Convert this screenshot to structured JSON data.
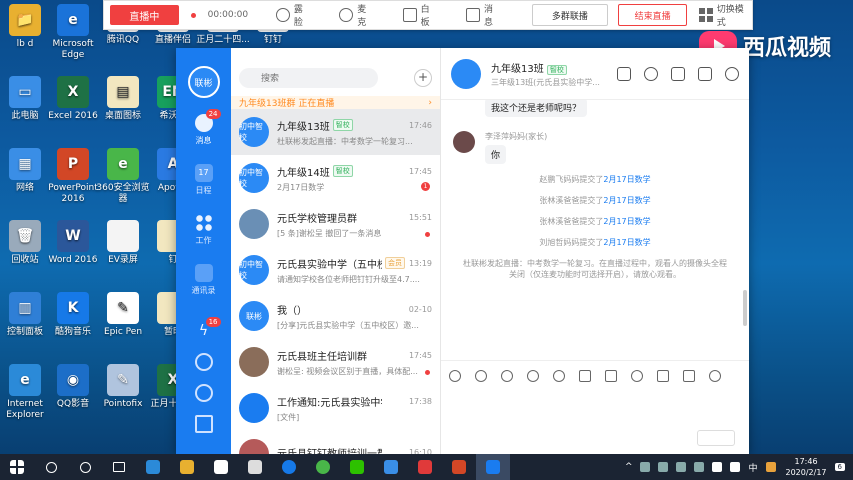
{
  "desktop": {
    "icons": [
      {
        "label": "lb d",
        "color": "#e8b030",
        "glyph": "📁"
      },
      {
        "label": "Microsoft Edge",
        "color": "#1a73d9",
        "glyph": "e"
      },
      {
        "label": "腾讯QQ",
        "color": "#f5f5f5",
        "glyph": ""
      },
      {
        "label": "直播伴侣",
        "color": "#f5f5f5",
        "glyph": ""
      },
      {
        "label": "正月二十四...",
        "color": "#f5f5f5",
        "glyph": ""
      },
      {
        "label": "钉钉",
        "color": "#f5f5f5",
        "glyph": ""
      },
      {
        "label": "此电脑",
        "color": "#3a8ee6",
        "glyph": "▭"
      },
      {
        "label": "Excel 2016",
        "color": "#1e7145",
        "glyph": "X"
      },
      {
        "label": "桌面图标",
        "color": "#f2e7c0",
        "glyph": "▤"
      },
      {
        "label": "希沃白",
        "color": "#17a05d",
        "glyph": "EN"
      },
      {
        "label": "网络",
        "color": "#3a8ee6",
        "glyph": "▦"
      },
      {
        "label": "PowerPoint 2016",
        "color": "#d24726",
        "glyph": "P"
      },
      {
        "label": "360安全浏览器",
        "color": "#49b649",
        "glyph": "e"
      },
      {
        "label": "Apowe",
        "color": "#2a7ae2",
        "glyph": "A"
      },
      {
        "label": "回收站",
        "color": "#9ab",
        "glyph": "🗑"
      },
      {
        "label": "Word 2016",
        "color": "#2b579a",
        "glyph": "W"
      },
      {
        "label": "EV录屏",
        "color": "#f4f4f4",
        "glyph": ""
      },
      {
        "label": "钉",
        "color": "#f2e7c0",
        "glyph": ""
      },
      {
        "label": "控制面板",
        "color": "#2f7fd6",
        "glyph": "▥"
      },
      {
        "label": "酷狗音乐",
        "color": "#1679e8",
        "glyph": "K"
      },
      {
        "label": "Epic Pen",
        "color": "#fff",
        "glyph": "✎"
      },
      {
        "label": "暂时",
        "color": "#f2e7c0",
        "glyph": ""
      },
      {
        "label": "Internet Explorer",
        "color": "#2b8ad8",
        "glyph": "e"
      },
      {
        "label": "QQ影音",
        "color": "#1c6ec8",
        "glyph": "◉"
      },
      {
        "label": "Pointofix",
        "color": "#b0c4de",
        "glyph": "✎"
      },
      {
        "label": "正月十三直",
        "color": "#1e7145",
        "glyph": "X"
      }
    ]
  },
  "live_bar": {
    "live_label": "直播中",
    "timer": "00:00:00",
    "tools": [
      "露脸",
      "麦克",
      "白板",
      "消息"
    ],
    "multi_live": "多群联播",
    "end_live": "结束直播",
    "switch_mode": "切换模式"
  },
  "watermark": {
    "text": "西瓜视频"
  },
  "rail": {
    "avatar_text": "联彬",
    "nav": [
      {
        "label": "消息",
        "badge": "24"
      },
      {
        "label": "日程",
        "badge": ""
      },
      {
        "label": "工作",
        "badge": ""
      },
      {
        "label": "通讯录",
        "badge": ""
      }
    ],
    "bottom_badge": "16"
  },
  "list": {
    "search_placeholder": "搜索",
    "live_banner": "九年级13班群 正在直播",
    "conversations": [
      {
        "name": "九年级13班",
        "tag": "智校",
        "tag_type": "green",
        "time": "17:46",
        "preview": "杜联彬发起直播：中考数学一轮复习...",
        "avatar_color": "#2b8af5",
        "avatar_text": "初中智校",
        "unread": ""
      },
      {
        "name": "九年级14班",
        "tag": "智校",
        "tag_type": "green",
        "time": "17:45",
        "preview": "2月17日数学",
        "avatar_color": "#2b8af5",
        "avatar_text": "初中智校",
        "unread": "1"
      },
      {
        "name": "元氏学校管理员群",
        "tag": "",
        "tag_type": "",
        "time": "15:51",
        "preview": "[5 条]谢松呈 撤回了一条消息",
        "avatar_color": "#6a8fb5",
        "avatar_text": "",
        "unread": "•"
      },
      {
        "name": "元氏县实验中学（五中校...",
        "tag": "会员",
        "tag_type": "vip",
        "time": "13:19",
        "preview": "请通知学校各位老师把钉钉升级至4.7....",
        "avatar_color": "#2b8af5",
        "avatar_text": "初中智校",
        "unread": ""
      },
      {
        "name": "我（）",
        "tag": "",
        "tag_type": "",
        "time": "02-10",
        "preview": "[分享]元氏县实验中学（五中校区）邀...",
        "avatar_color": "#2b8af5",
        "avatar_text": "联彬",
        "unread": ""
      },
      {
        "name": "元氏县班主任培训群",
        "tag": "",
        "tag_type": "",
        "time": "17:45",
        "preview": "谢松呈: 视频会议区别于直播，具体配...",
        "avatar_color": "#8a6d5a",
        "avatar_text": "",
        "unread": "•"
      },
      {
        "name": "工作通知:元氏县实验中学（五...",
        "tag": "",
        "tag_type": "",
        "time": "17:38",
        "preview": "[文件]",
        "avatar_color": "#1a7cf0",
        "avatar_text": "",
        "unread": ""
      },
      {
        "name": "元氏县钉钉教师培训一群",
        "tag": "",
        "tag_type": "",
        "time": "16:10",
        "preview": "",
        "avatar_color": "#b55a5a",
        "avatar_text": "",
        "unread": ""
      }
    ]
  },
  "chat": {
    "title": "九年级13班",
    "title_tag": "智校",
    "subtitle": "三年级13班(元氏县实验中学...",
    "partial_top": "我这个还是老师呢吗？",
    "sender": "李泽萍妈妈(家长)",
    "sender_msg": "你",
    "system_msgs": [
      {
        "who": "赵鹏飞妈妈提交了",
        "link": "2月17日数学"
      },
      {
        "who": "张林溪爸爸提交了",
        "link": "2月17日数学"
      },
      {
        "who": "张林溪爸爸提交了",
        "link": "2月17日数学"
      },
      {
        "who": "刘旭哲妈妈提交了",
        "link": "2月17日数学"
      }
    ],
    "live_notice": "杜联彬发起直播：中考数学一轮复习。在直播过程中，观看人的摄像头全程关闭（仅连麦功能时可选择开启），请放心观看。"
  },
  "taskbar": {
    "clock_time": "17:46",
    "clock_date": "2020/2/17",
    "ime": "中",
    "notif": "6"
  }
}
